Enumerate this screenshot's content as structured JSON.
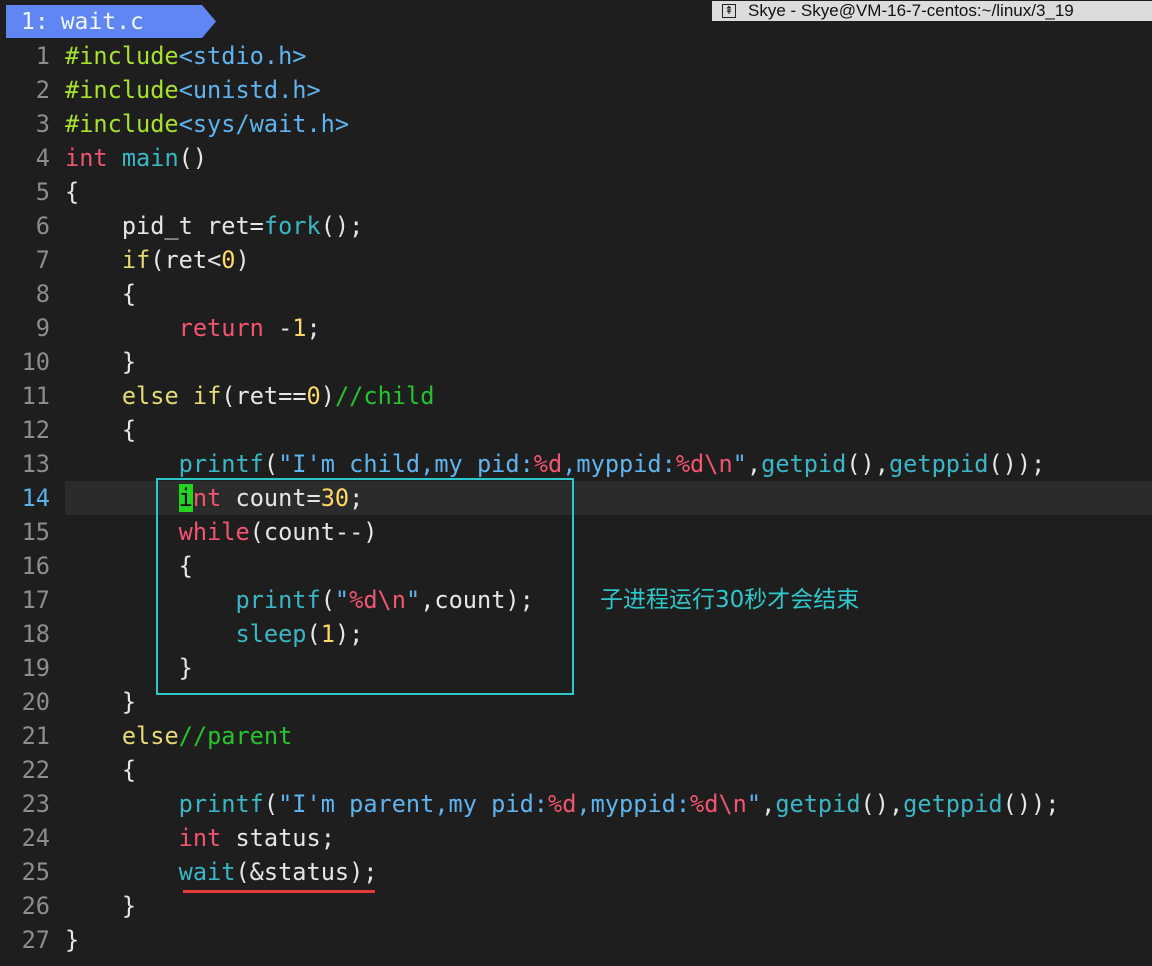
{
  "tab": {
    "number": "1:",
    "filename": "wait.c"
  },
  "window": {
    "title": "Skye - Skye@VM-16-7-centos:~/linux/3_19"
  },
  "colors": {
    "highlight_box": "#2ec8cc",
    "underline": "#e53935",
    "cursor": "#22d41e",
    "tab": "#5f86f2"
  },
  "annotation": {
    "note": "子进程运行30秒才会结束"
  },
  "code": {
    "current_line": 14,
    "lines": [
      {
        "n": "1"
      },
      {
        "n": "2"
      },
      {
        "n": "3"
      },
      {
        "n": "4"
      },
      {
        "n": "5"
      },
      {
        "n": "6"
      },
      {
        "n": "7"
      },
      {
        "n": "8"
      },
      {
        "n": "9"
      },
      {
        "n": "10"
      },
      {
        "n": "11"
      },
      {
        "n": "12"
      },
      {
        "n": "13"
      },
      {
        "n": "14"
      },
      {
        "n": "15"
      },
      {
        "n": "16"
      },
      {
        "n": "17"
      },
      {
        "n": "18"
      },
      {
        "n": "19"
      },
      {
        "n": "20"
      },
      {
        "n": "21"
      },
      {
        "n": "22"
      },
      {
        "n": "23"
      },
      {
        "n": "24"
      },
      {
        "n": "25"
      },
      {
        "n": "26"
      },
      {
        "n": "27"
      }
    ],
    "tokens": {
      "l1": [
        "#include",
        "<stdio.h>"
      ],
      "l2": [
        "#include",
        "<unistd.h>"
      ],
      "l3": [
        "#include",
        "<sys/wait.h>"
      ],
      "l4": [
        "int",
        " ",
        "main",
        "()"
      ],
      "l5": [
        "{"
      ],
      "l6": [
        "    pid_t ret=",
        "fork",
        "();"
      ],
      "l7": [
        "    ",
        "if",
        "(ret<",
        "0",
        ")"
      ],
      "l8": [
        "    {"
      ],
      "l9": [
        "        ",
        "return",
        " -",
        "1",
        ";"
      ],
      "l10": [
        "    }"
      ],
      "l11": [
        "    ",
        "else",
        " ",
        "if",
        "(ret==",
        "0",
        ")",
        "//child"
      ],
      "l12": [
        "    {"
      ],
      "l13": [
        "        ",
        "printf",
        "(",
        "\"I'm child,my pid:",
        "%d",
        ",myppid:",
        "%d\\n",
        "\"",
        ",",
        "getpid",
        "(),",
        "getppid",
        "());"
      ],
      "l14": [
        "        ",
        "i",
        "nt",
        " count=",
        "30",
        ";"
      ],
      "l15": [
        "        ",
        "while",
        "(count--)"
      ],
      "l16": [
        "        {"
      ],
      "l17": [
        "            ",
        "printf",
        "(",
        "\"",
        "%d\\n",
        "\"",
        ",count);"
      ],
      "l18": [
        "            ",
        "sleep",
        "(",
        "1",
        ");"
      ],
      "l19": [
        "        }"
      ],
      "l20": [
        "    }"
      ],
      "l21": [
        "    ",
        "else",
        "//parent"
      ],
      "l22": [
        "    {"
      ],
      "l23": [
        "        ",
        "printf",
        "(",
        "\"I'm parent,my pid:",
        "%d",
        ",myppid:",
        "%d\\n",
        "\"",
        ",",
        "getpid",
        "(),",
        "getppid",
        "());"
      ],
      "l24": [
        "        ",
        "int",
        " status;"
      ],
      "l25": [
        "        ",
        "wait",
        "(&status);"
      ],
      "l26": [
        "    }"
      ],
      "l27": [
        "}"
      ]
    }
  }
}
